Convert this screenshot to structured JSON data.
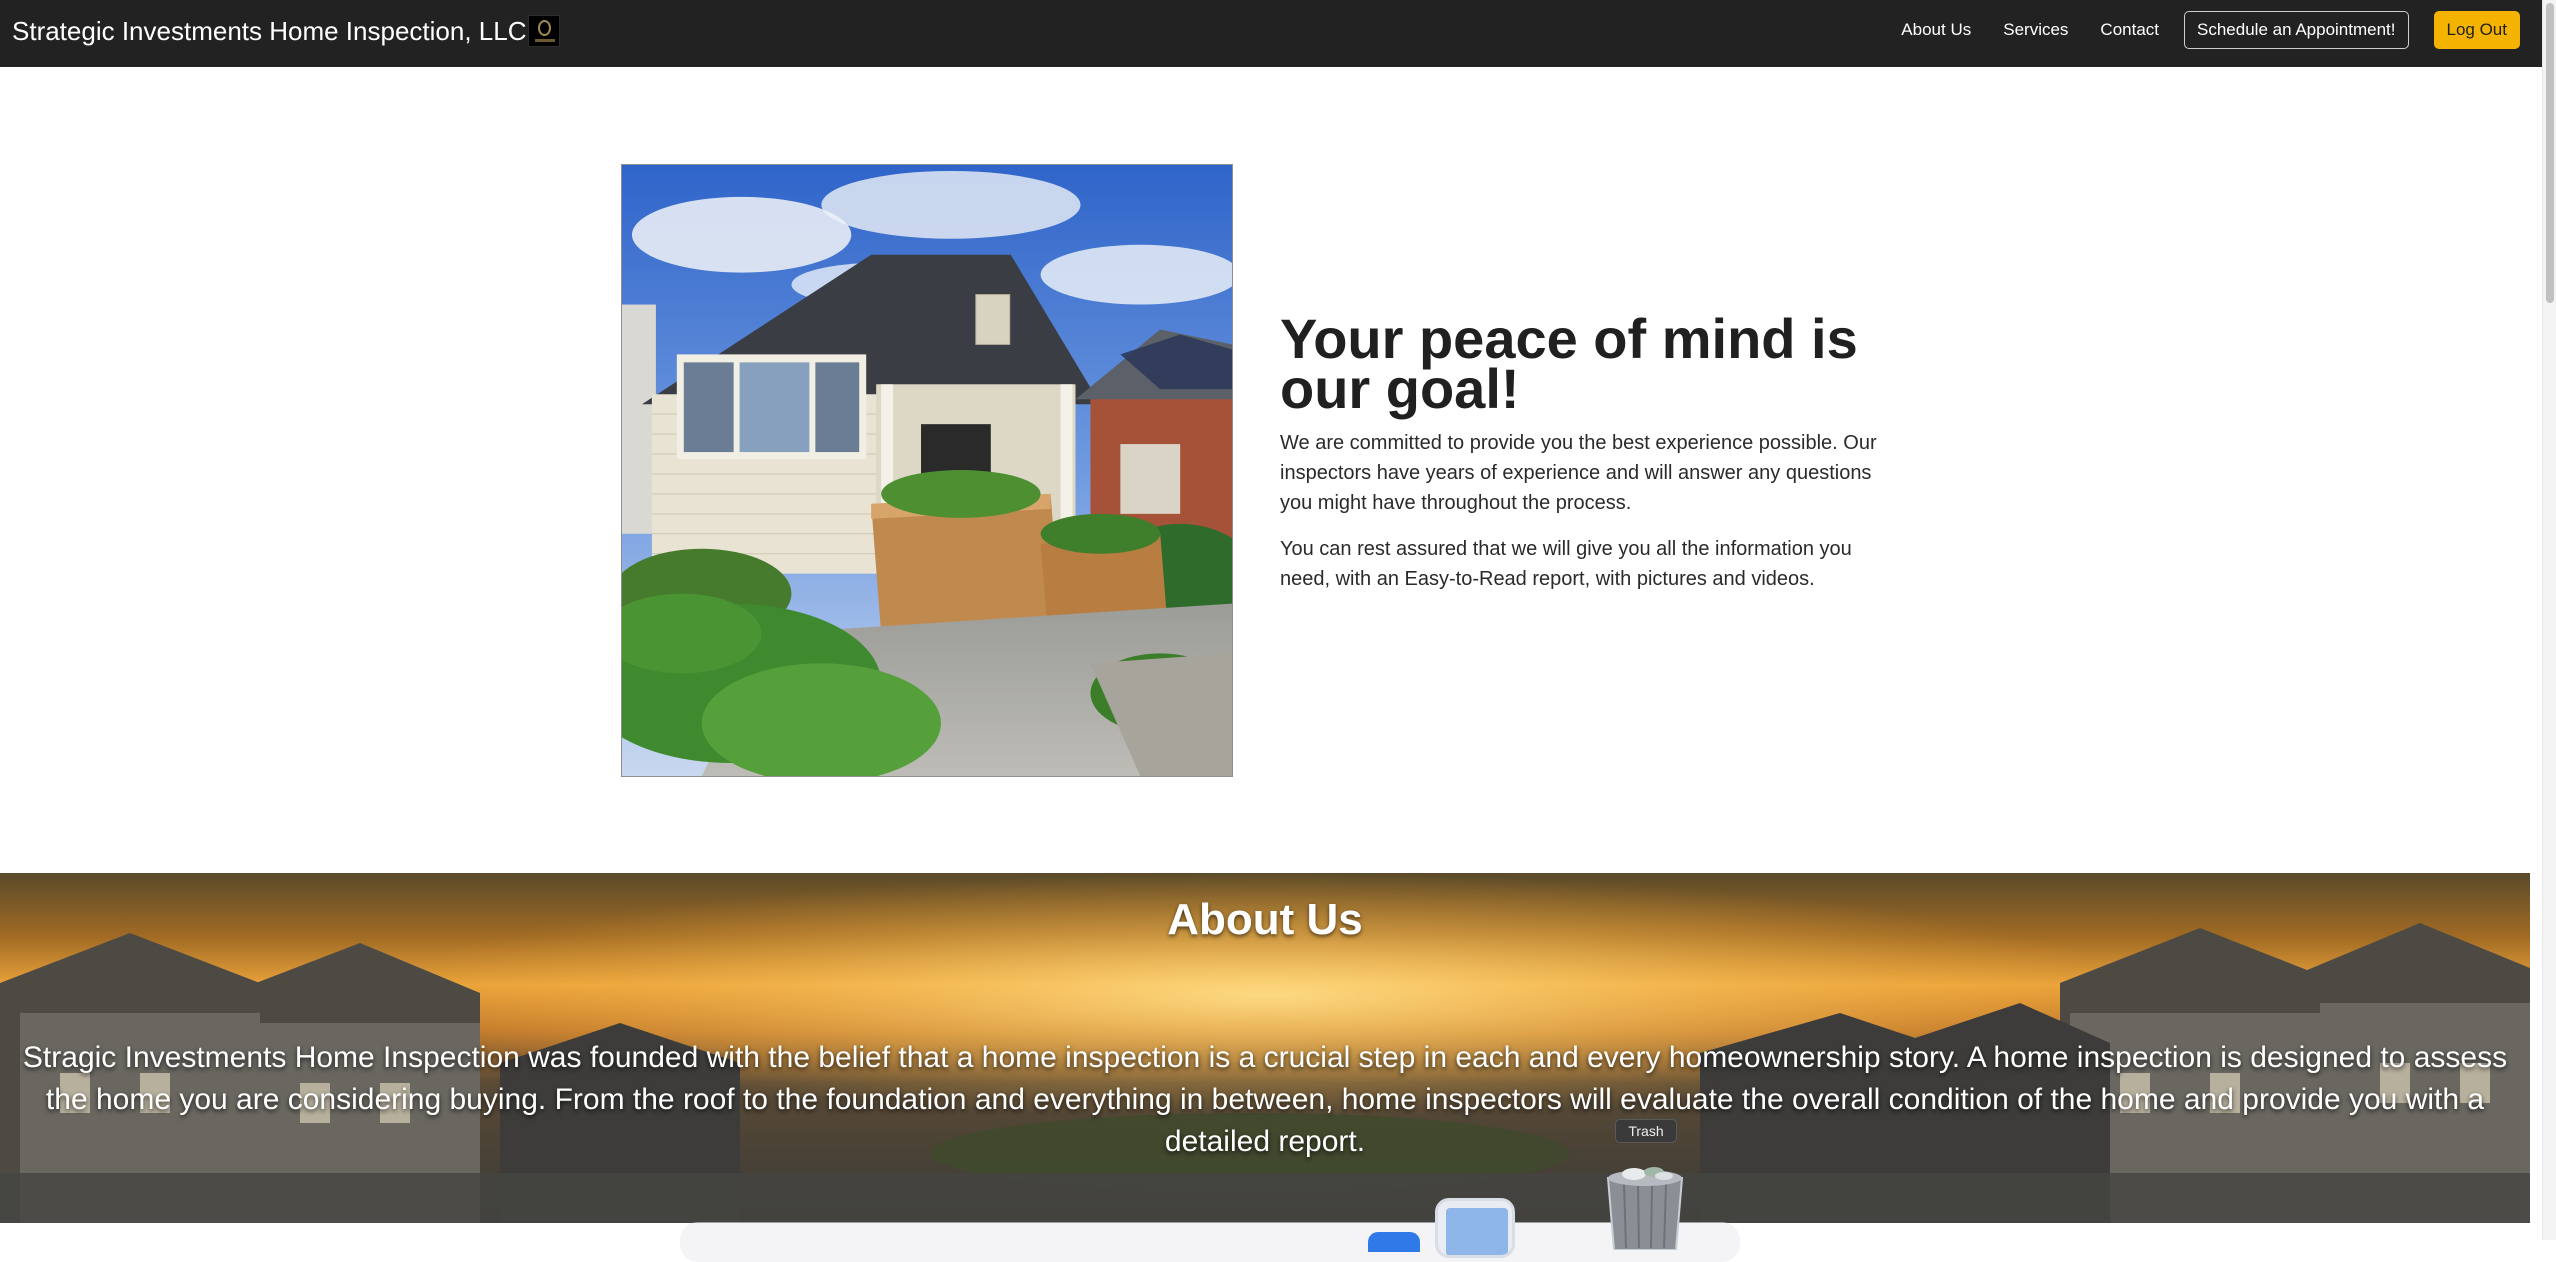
{
  "navbar": {
    "brand": "Strategic Investments Home Inspection, LLC",
    "links": {
      "about": "About Us",
      "services": "Services",
      "contact": "Contact"
    },
    "schedule_button": "Schedule an Appointment!",
    "logout_button": "Log Out"
  },
  "hero": {
    "title": "Your peace of mind is our goal!",
    "paragraph_1": "We are committed to provide you the best experience possible. Our inspectors have years of experience and will answer any questions you might have throughout the process.",
    "paragraph_2": "You can rest assured that we will give you all the information you need, with an Easy-to-Read report, with pictures and videos."
  },
  "about": {
    "title": "About Us",
    "body": "Stragic Investments Home Inspection was founded with the belief that a home inspection is a crucial step in each and every homeownership story. A home inspection is designed to assess the home you are considering buying. From the roof to the foundation and everything in between, home inspectors will evaluate the overall condition of the home and provide you with a detailed report."
  },
  "dock": {
    "tooltip": "Trash"
  },
  "colors": {
    "navbar_bg": "#222222",
    "logout_accent": "#f5b301",
    "page_bg": "#ffffff"
  },
  "icons": {
    "brand_logo": "logo-icon",
    "trash": "trash-icon",
    "finder": "finder-icon"
  }
}
